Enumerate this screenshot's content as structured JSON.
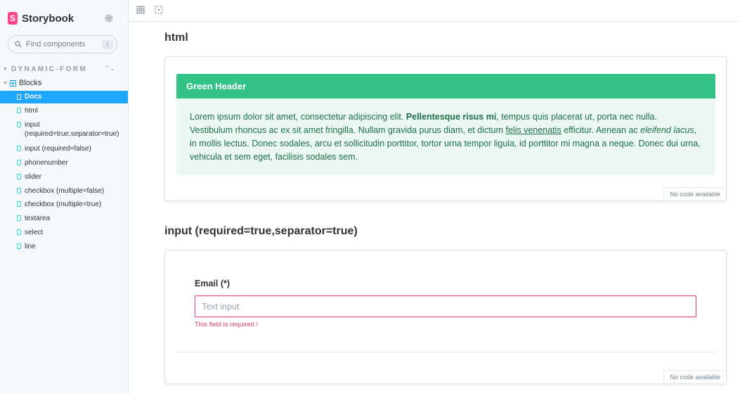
{
  "sidebar": {
    "brand": "Storybook",
    "search_placeholder": "Find components",
    "search_shortcut": "/",
    "section": "DYNAMIC-FORM",
    "group": "Blocks",
    "items": [
      {
        "label": "Docs"
      },
      {
        "label": "html"
      },
      {
        "label": "input (required=true,separator=true)"
      },
      {
        "label": "input (required=false)"
      },
      {
        "label": "phonenumber"
      },
      {
        "label": "slider"
      },
      {
        "label": "checkbox (multiple=false)"
      },
      {
        "label": "checkbox (multiple=true)"
      },
      {
        "label": "textarea"
      },
      {
        "label": "select"
      },
      {
        "label": "line"
      }
    ],
    "active_index": 0
  },
  "colors": {
    "accent": "#1ea7fd",
    "brand": "#ff4785",
    "green_header": "#33c386",
    "error": "#dc3c64"
  },
  "main": {
    "stories": [
      {
        "title": "html",
        "green_header": "Green Header",
        "paragraph": {
          "p1": "Lorem ipsum dolor sit amet, consectetur adipiscing elit. ",
          "bold": "Pellentesque risus mi",
          "p2": ", tempus quis placerat ut, porta nec nulla. Vestibulum rhoncus ac ex sit amet fringilla. Nullam gravida purus diam, et dictum ",
          "underline": "felis venenatis",
          "p3": " efficitur. Aenean ac ",
          "italic": "eleifend lacus",
          "p4": ", in mollis lectus. Donec sodales, arcu et sollicitudin porttitor, tortor urna tempor ligula, id porttitor mi magna a neque. Donec dui urna, vehicula et sem eget, facilisis sodales sem."
        },
        "no_code": "No code available"
      },
      {
        "title": "input (required=true,separator=true)",
        "field_label": "Email (*)",
        "field_placeholder": "Text input",
        "field_value": "",
        "error": "This field is required !",
        "no_code": "No code available"
      }
    ]
  }
}
